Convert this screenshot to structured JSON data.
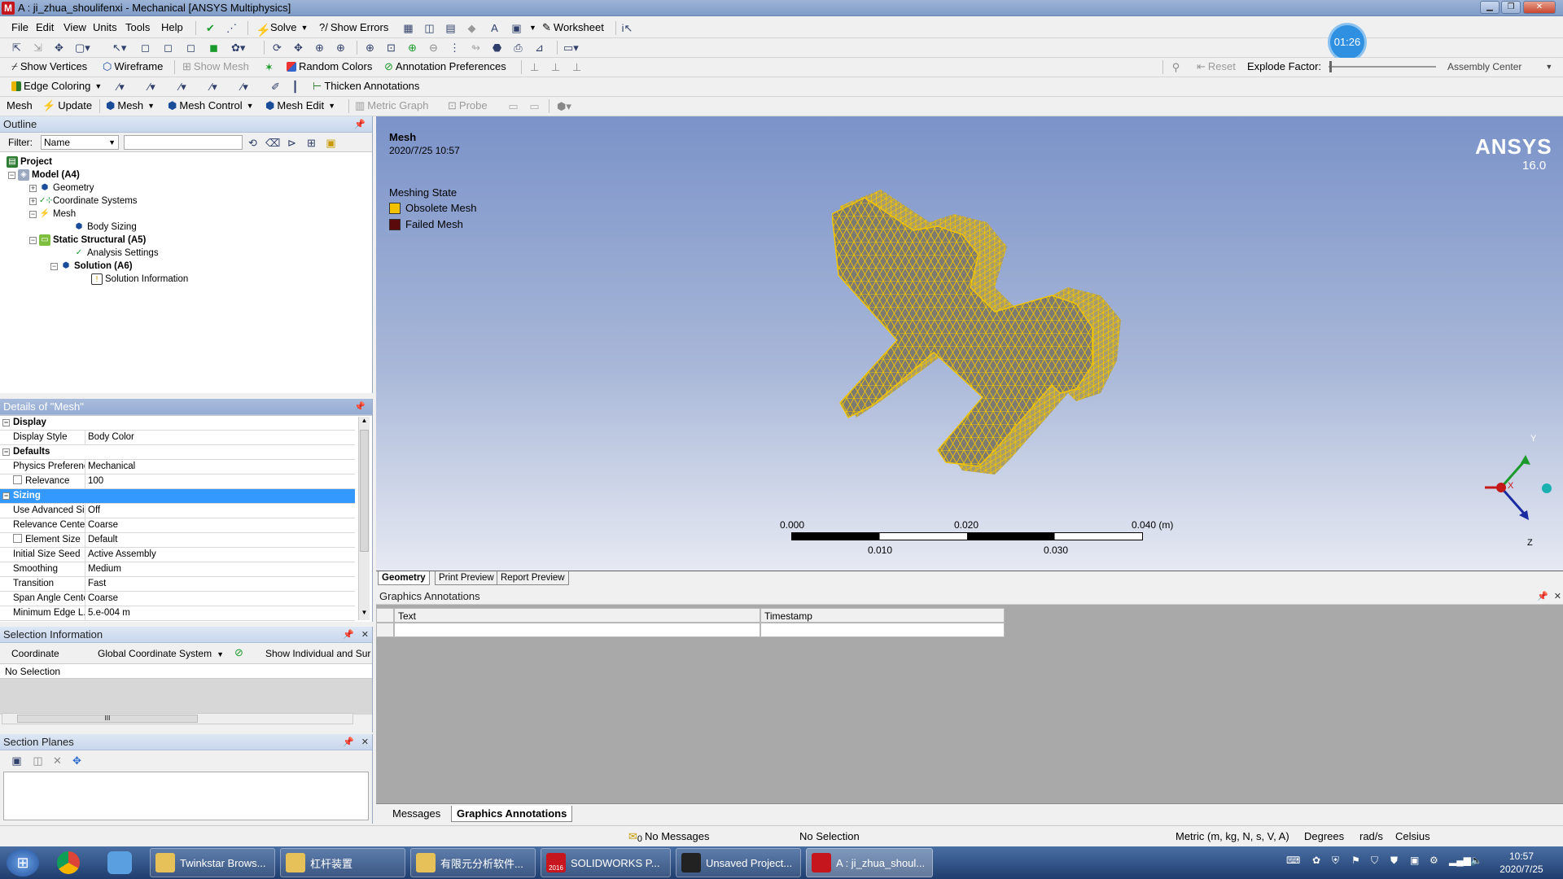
{
  "window": {
    "title": "A : ji_zhua_shoulifenxi - Mechanical [ANSYS Multiphysics]",
    "app_badge": "M"
  },
  "menu": [
    "File",
    "Edit",
    "View",
    "Units",
    "Tools",
    "Help"
  ],
  "toolbar1": {
    "solve": "Solve",
    "show_errors": "Show Errors",
    "worksheet": "Worksheet"
  },
  "toolbar2": {
    "timer": "01:26"
  },
  "toolbar3": {
    "show_vertices": "Show Vertices",
    "wireframe": "Wireframe",
    "show_mesh": "Show Mesh",
    "random_colors": "Random Colors",
    "annotation_preferences": "Annotation Preferences",
    "reset": "Reset",
    "explode_factor": "Explode Factor:",
    "assembly_center": "Assembly Center"
  },
  "toolbar4": {
    "edge_coloring": "Edge Coloring",
    "thicken_annotations": "Thicken Annotations"
  },
  "toolbar5": {
    "mesh": "Mesh",
    "update": "Update",
    "mesh_menu": "Mesh",
    "mesh_control": "Mesh Control",
    "mesh_edit": "Mesh Edit",
    "metric_graph": "Metric Graph",
    "probe": "Probe"
  },
  "outline": {
    "title": "Outline",
    "filter_label": "Filter:",
    "filter_value": "Name",
    "tree": [
      {
        "label": "Project",
        "bold": true
      },
      {
        "label": "Model (A4)",
        "bold": true
      },
      {
        "label": "Geometry",
        "bold": false
      },
      {
        "label": "Coordinate Systems",
        "bold": false
      },
      {
        "label": "Mesh",
        "bold": false
      },
      {
        "label": "Body Sizing",
        "bold": false
      },
      {
        "label": "Static Structural (A5)",
        "bold": true
      },
      {
        "label": "Analysis Settings",
        "bold": false
      },
      {
        "label": "Solution (A6)",
        "bold": true
      },
      {
        "label": "Solution Information",
        "bold": false
      }
    ]
  },
  "details": {
    "title": "Details of \"Mesh\"",
    "rows": [
      {
        "k": "Display",
        "v": "",
        "type": "hdr"
      },
      {
        "k": "Display Style",
        "v": "Body Color",
        "type": "row"
      },
      {
        "k": "Defaults",
        "v": "",
        "type": "hdr"
      },
      {
        "k": "Physics Preference",
        "v": "Mechanical",
        "type": "row"
      },
      {
        "k": "Relevance",
        "v": "100",
        "type": "check"
      },
      {
        "k": "Sizing",
        "v": "",
        "type": "sel"
      },
      {
        "k": "Use Advanced Siz...",
        "v": "Off",
        "type": "row"
      },
      {
        "k": "Relevance Center",
        "v": "Coarse",
        "type": "row"
      },
      {
        "k": "Element Size",
        "v": "Default",
        "type": "check"
      },
      {
        "k": "Initial Size Seed",
        "v": "Active Assembly",
        "type": "row"
      },
      {
        "k": "Smoothing",
        "v": "Medium",
        "type": "row"
      },
      {
        "k": "Transition",
        "v": "Fast",
        "type": "row"
      },
      {
        "k": "Span Angle Center",
        "v": "Coarse",
        "type": "row"
      },
      {
        "k": "Minimum Edge L...",
        "v": "5.e-004 m",
        "type": "row"
      }
    ]
  },
  "selection_info": {
    "title": "Selection Information",
    "coordinate_label": "Coordinate",
    "coordinate_value": "Global Coordinate System",
    "show_label": "Show Individual and Sur",
    "no_selection": "No Selection",
    "scroll_mark": "III"
  },
  "section_planes": {
    "title": "Section Planes"
  },
  "graphics": {
    "title": "Mesh",
    "timestamp": "2020/7/25 10:57",
    "brand": "ANSYS",
    "version": "16.0",
    "legend_title": "Meshing State",
    "legend": [
      {
        "label": "Obsolete Mesh",
        "color": "#f2c200"
      },
      {
        "label": "Failed Mesh",
        "color": "#5a0a0a"
      }
    ],
    "scale_top": [
      "0.000",
      "0.020",
      "0.040 (m)"
    ],
    "scale_bottom": [
      "0.010",
      "0.030"
    ],
    "axes": {
      "y": "Y",
      "z": "Z",
      "x": "X"
    },
    "mesh_color": "#f0c400",
    "body_color": "#7d7a72"
  },
  "view_tabs": [
    "Geometry",
    "Print Preview",
    "Report Preview"
  ],
  "annotations": {
    "title": "Graphics Annotations",
    "cols": [
      "Text",
      "Timestamp"
    ]
  },
  "bottom_tabs": [
    "Messages",
    "Graphics Annotations"
  ],
  "status": {
    "messages": "No Messages",
    "messages_count": "0",
    "selection": "No Selection",
    "units": "Metric (m, kg, N, s, V, A)",
    "angle": "Degrees",
    "rot": "rad/s",
    "temp": "Celsius"
  },
  "taskbar": {
    "items": [
      {
        "label": "Twinkstar Brows...",
        "color": "#e6c15a"
      },
      {
        "label": "杠杆装置",
        "color": "#e6c15a"
      },
      {
        "label": "有限元分析软件...",
        "color": "#e6c15a"
      },
      {
        "label": "SOLIDWORKS P...",
        "color": "#c8161e",
        "badge": "2016"
      },
      {
        "label": "Unsaved Project...",
        "color": "#222"
      },
      {
        "label": "A : ji_zhua_shoul...",
        "color": "#c4161c"
      }
    ],
    "time": "10:57",
    "date": "2020/7/25"
  }
}
